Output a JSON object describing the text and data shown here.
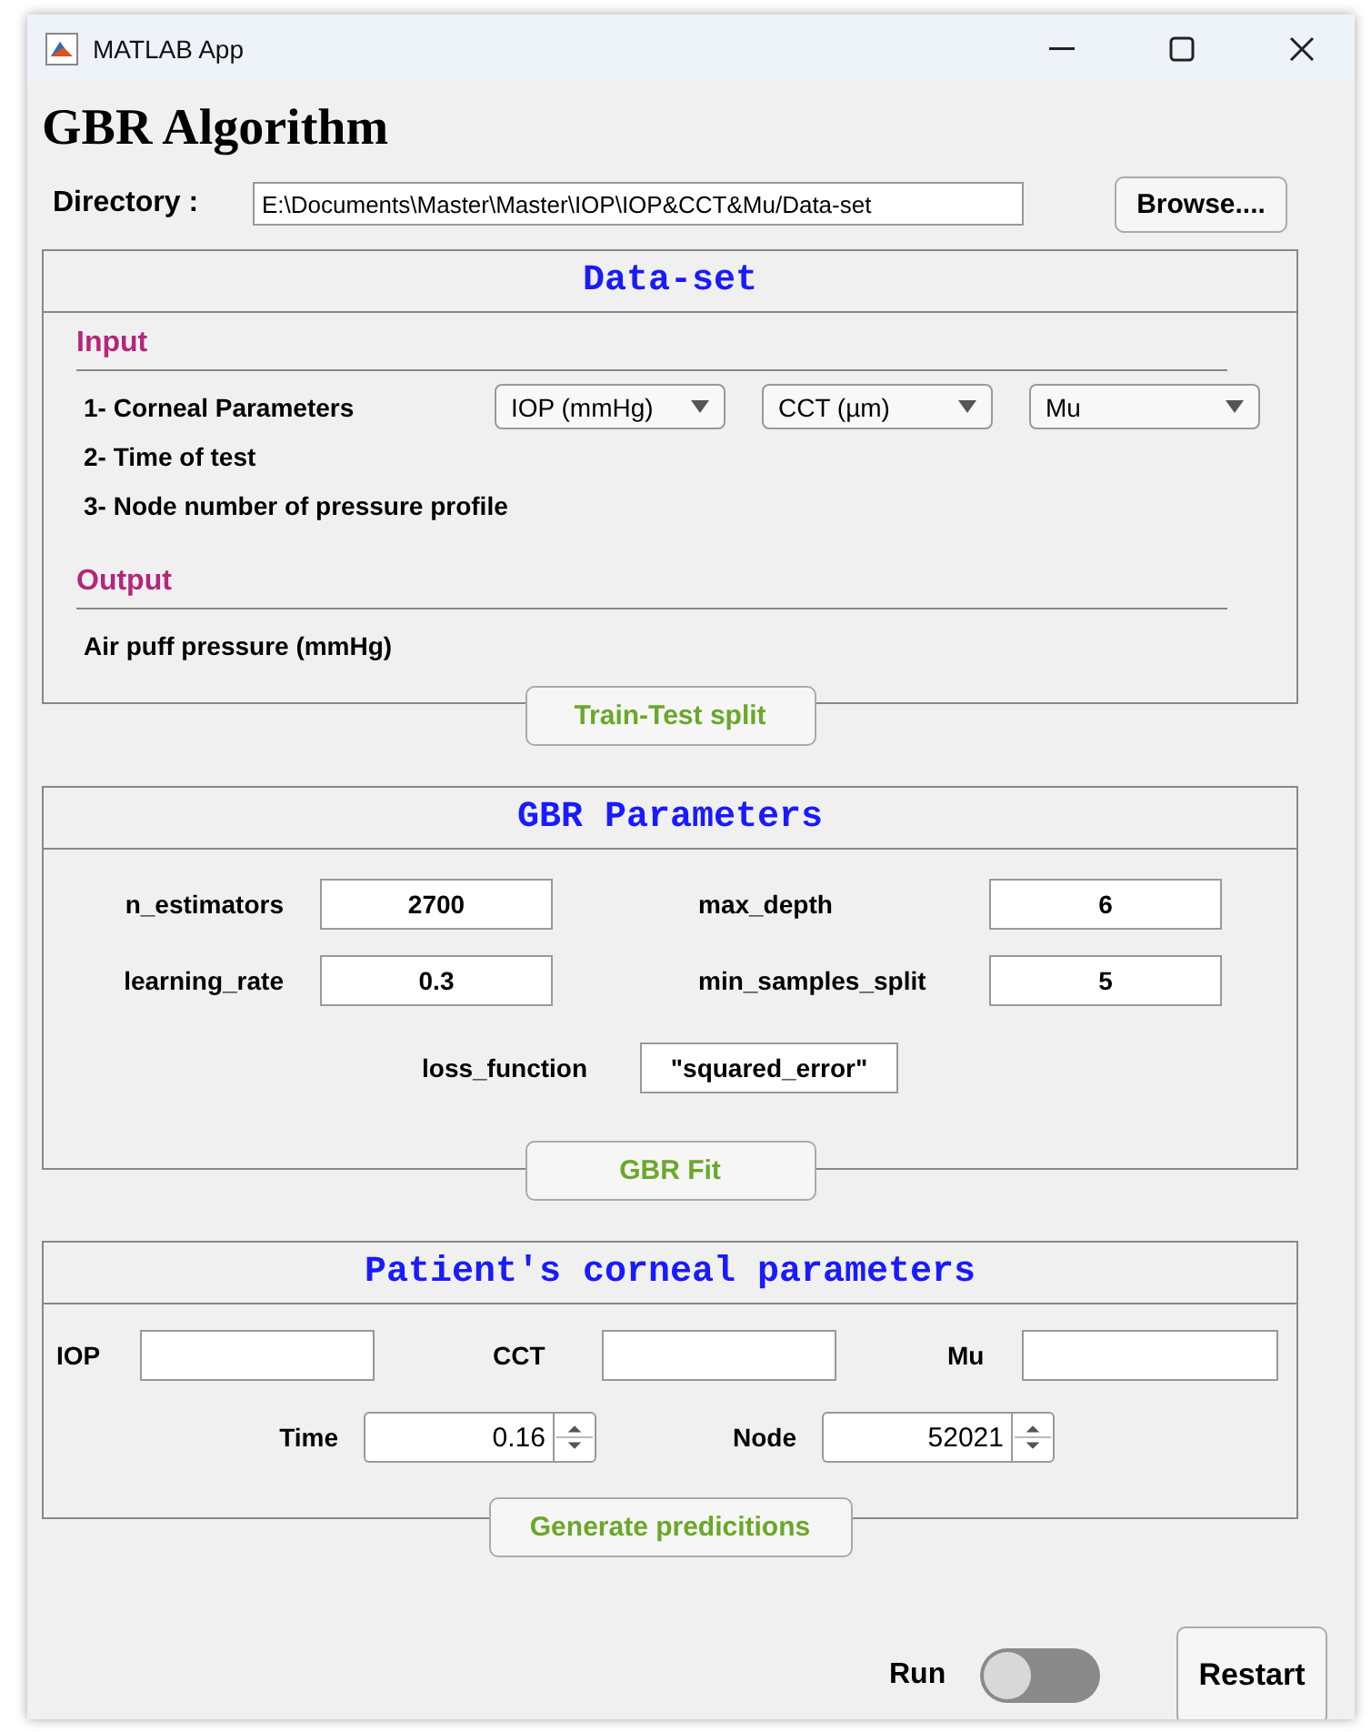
{
  "window": {
    "title": "MATLAB App"
  },
  "heading": "GBR Algorithm",
  "directory": {
    "label": "Directory :",
    "value": "E:\\Documents\\Master\\Master\\IOP\\IOP&CCT&Mu/Data-set",
    "button": "Browse...."
  },
  "dataset": {
    "title": "Data-set",
    "sections": [
      {
        "heading": "Input",
        "items": [
          {
            "text": "1- Corneal Parameters",
            "dropdowns": [
              "IOP (mmHg)",
              "CCT (µm)",
              "Mu"
            ]
          },
          {
            "text": "2- Time of test"
          },
          {
            "text": "3- Node number of pressure profile"
          }
        ]
      },
      {
        "heading": "Output",
        "items": [
          {
            "text": "Air puff pressure (mmHg)"
          }
        ]
      }
    ],
    "button": "Train-Test split"
  },
  "gbr": {
    "title": "GBR Parameters",
    "fields": [
      {
        "label": "n_estimators",
        "value": "2700"
      },
      {
        "label": "max_depth",
        "value": "6"
      },
      {
        "label": "learning_rate",
        "value": "0.3"
      },
      {
        "label": "min_samples_split",
        "value": "5"
      }
    ],
    "loss": {
      "label": "loss_function",
      "value": "\"squared_error\""
    },
    "button": "GBR Fit"
  },
  "patient": {
    "title": "Patient's corneal parameters",
    "fields": [
      {
        "label": "IOP"
      },
      {
        "label": "CCT"
      },
      {
        "label": "Mu"
      }
    ],
    "spinners": [
      {
        "label": "Time",
        "value": "0.16"
      },
      {
        "label": "Node",
        "value": "52021"
      }
    ],
    "button": "Generate predicitions"
  },
  "run": {
    "label": "Run",
    "on": false
  },
  "restart": "Restart"
}
